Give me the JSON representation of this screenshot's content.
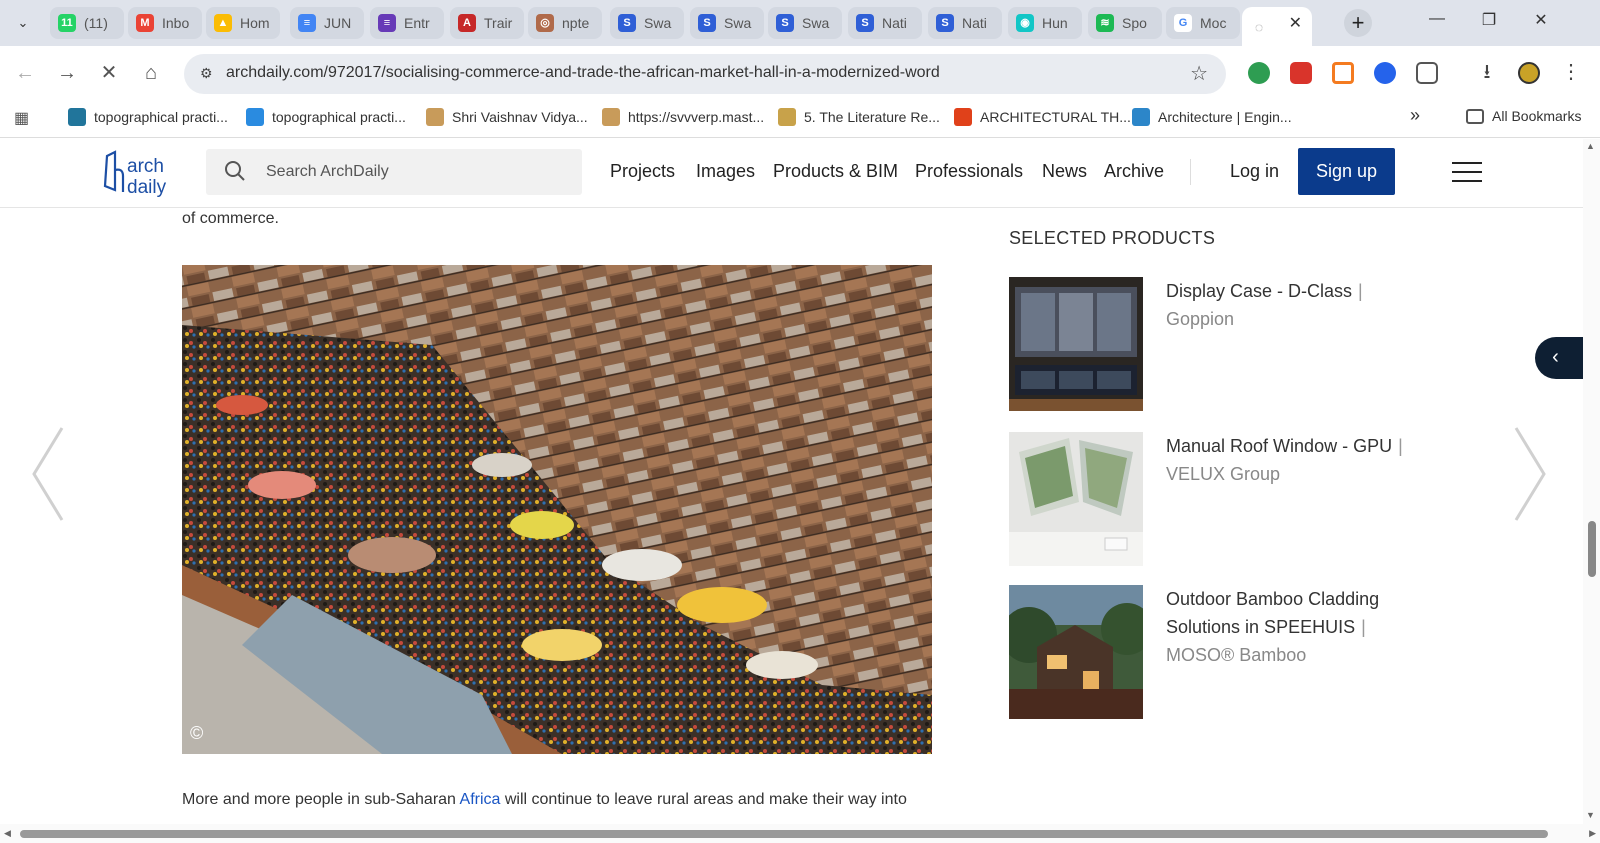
{
  "browser": {
    "tabs": [
      {
        "label": "(11)",
        "icon": "whatsapp-icon",
        "color": "#25d366",
        "glyph": "11"
      },
      {
        "label": "Inbo",
        "icon": "gmail-icon",
        "color": "#ea4335",
        "glyph": "M"
      },
      {
        "label": "Hom",
        "icon": "drive-icon",
        "color": "#fbbc04",
        "glyph": "▲"
      },
      {
        "label": "JUN",
        "icon": "docs-icon",
        "color": "#4285f4",
        "glyph": "≡"
      },
      {
        "label": "Entr",
        "icon": "forms-icon",
        "color": "#673ab7",
        "glyph": "≡"
      },
      {
        "label": "Trair",
        "icon": "pdf-icon",
        "color": "#c62828",
        "glyph": "A"
      },
      {
        "label": "npte",
        "icon": "nptel-icon",
        "color": "#b06a4a",
        "glyph": "◎"
      },
      {
        "label": "Swa",
        "icon": "swayam-icon",
        "color": "#2f5fd6",
        "glyph": "S"
      },
      {
        "label": "Swa",
        "icon": "swayam-icon",
        "color": "#2f5fd6",
        "glyph": "S"
      },
      {
        "label": "Swa",
        "icon": "swayam-icon",
        "color": "#2f5fd6",
        "glyph": "S"
      },
      {
        "label": "Nati",
        "icon": "swayam-icon",
        "color": "#2f5fd6",
        "glyph": "S"
      },
      {
        "label": "Nati",
        "icon": "swayam-icon",
        "color": "#2f5fd6",
        "glyph": "S"
      },
      {
        "label": "Hun",
        "icon": "hun-icon",
        "color": "#12c6c6",
        "glyph": "◉"
      },
      {
        "label": "Spo",
        "icon": "spotify-icon",
        "color": "#1db954",
        "glyph": "≋"
      },
      {
        "label": "Moc",
        "icon": "google-icon",
        "color": "#ffffff",
        "glyph": "G"
      }
    ],
    "active_tab_close": "✕",
    "new_tab": "+",
    "window_controls": [
      "—",
      "❐",
      "✕"
    ],
    "url": "archdaily.com/972017/socialising-commerce-and-trade-the-african-market-hall-in-a-modernized-word",
    "bookmarks": [
      {
        "label": "topographical practi...",
        "icon": "wordpress-icon",
        "color": "#21759b"
      },
      {
        "label": "topographical practi...",
        "icon": "folder-icon",
        "color": "#2a8be0"
      },
      {
        "label": "Shri Vaishnav Vidya...",
        "icon": "university-icon",
        "color": "#c89b5a"
      },
      {
        "label": "https://svvverp.mast...",
        "icon": "university-icon",
        "color": "#c89b5a"
      },
      {
        "label": "5. The Literature Re...",
        "icon": "lamp-icon",
        "color": "#c8a24a"
      },
      {
        "label": "ARCHITECTURAL TH...",
        "icon": "architectural-icon",
        "color": "#e0411a"
      },
      {
        "label": "Architecture | Engin...",
        "icon": "engin-icon",
        "color": "#2c86c9"
      }
    ],
    "bookmarks_overflow": "»",
    "all_bookmarks": "All Bookmarks"
  },
  "site": {
    "search_placeholder": "Search ArchDaily",
    "nav": [
      "Projects",
      "Images",
      "Products & BIM",
      "Professionals",
      "News",
      "Archive"
    ],
    "login": "Log in",
    "signup": "Sign up",
    "brand_color": "#0b3b8c"
  },
  "article": {
    "lead_text": "of commerce.",
    "photo_credit": "©",
    "paragraph_before": "More and more people in sub-Saharan ",
    "paragraph_link": "Africa",
    "paragraph_after": " will continue to leave rural areas and make their way into"
  },
  "sidebar": {
    "title": "SELECTED PRODUCTS",
    "products": [
      {
        "name": "Display Case - D-Class",
        "brand": "Goppion"
      },
      {
        "name": "Manual Roof Window - GPU",
        "brand": "VELUX Group"
      },
      {
        "name": "Outdoor Bamboo Cladding Solutions in SPEEHUIS",
        "brand": "MOSO® Bamboo"
      }
    ],
    "separator": "|",
    "collapse_icon": "‹"
  }
}
